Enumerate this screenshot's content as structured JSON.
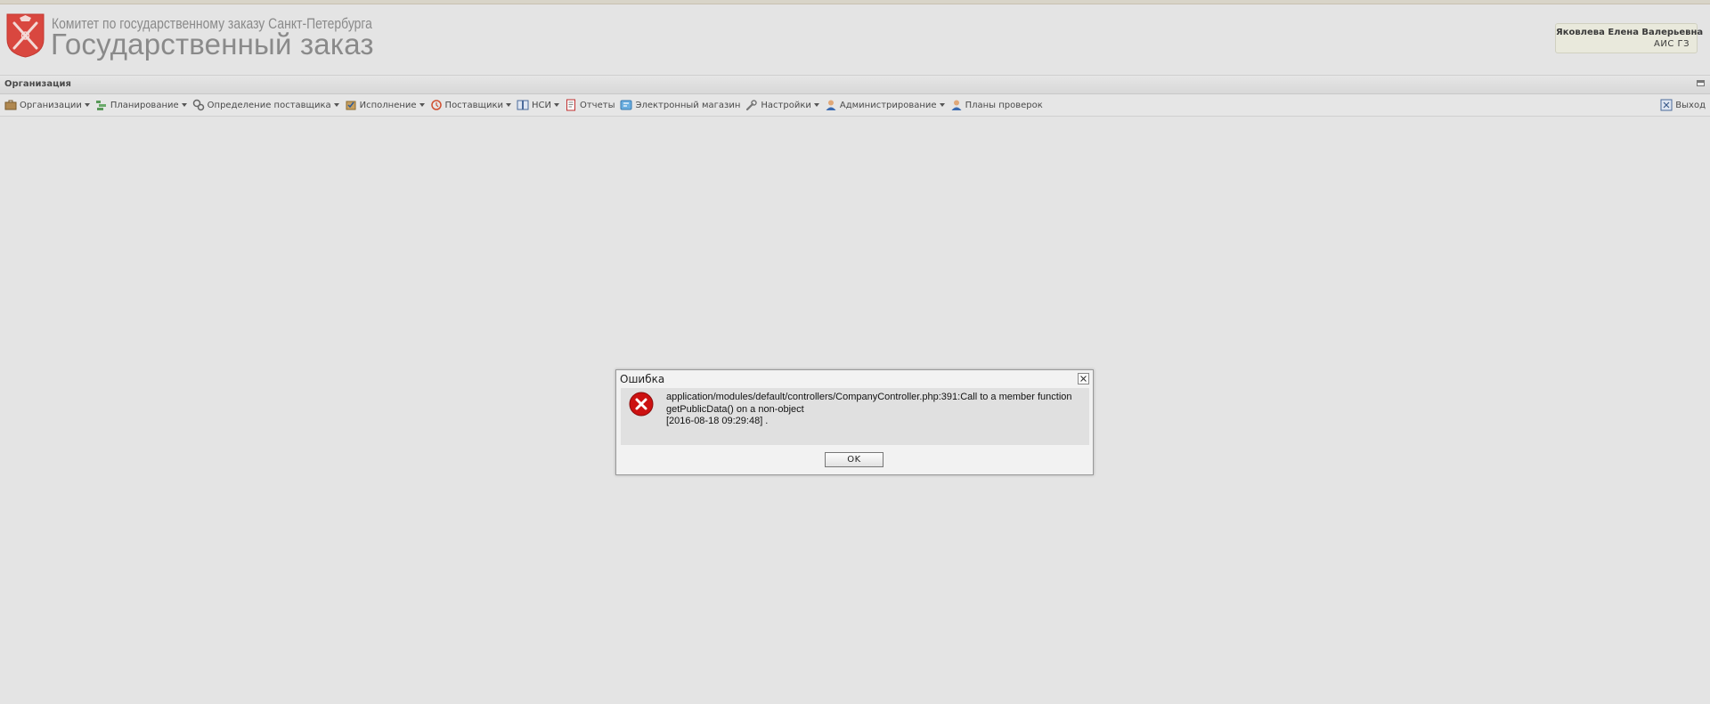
{
  "header": {
    "org_title": "Комитет по государственному заказу Санкт-Петербурга",
    "app_title": "Государственный заказ",
    "user": {
      "name": "Яковлева Елена Валерьевна",
      "system": "АИС ГЗ"
    }
  },
  "panel": {
    "title": "Организация"
  },
  "menu": {
    "items": [
      {
        "label": "Организации",
        "icon": "briefcase-icon",
        "dropdown": true
      },
      {
        "label": "Планирование",
        "icon": "plan-list-icon",
        "dropdown": true
      },
      {
        "label": "Определение поставщика",
        "icon": "gears-icon",
        "dropdown": true
      },
      {
        "label": "Исполнение",
        "icon": "execution-icon",
        "dropdown": true
      },
      {
        "label": "Поставщики",
        "icon": "suppliers-icon",
        "dropdown": true
      },
      {
        "label": "НСИ",
        "icon": "reference-book-icon",
        "dropdown": true
      },
      {
        "label": "Отчеты",
        "icon": "report-icon",
        "dropdown": false
      },
      {
        "label": "Электронный магазин",
        "icon": "shop-icon",
        "dropdown": false
      },
      {
        "label": "Настройки",
        "icon": "wrench-icon",
        "dropdown": true
      },
      {
        "label": "Администрирование",
        "icon": "admin-user-icon",
        "dropdown": true
      },
      {
        "label": "Планы проверок",
        "icon": "inspection-user-icon",
        "dropdown": false
      }
    ],
    "exit_label": "Выход"
  },
  "dialog": {
    "title": "Ошибка",
    "message_line1": "application/modules/default/controllers/CompanyController.php:391:Call to a member function",
    "message_line2": "getPublicData() on a non-object",
    "message_line3": "[2016-08-18 09:29:48] .",
    "ok_label": "OK"
  },
  "colors": {
    "background": "#e4e4e4",
    "emblem_red": "#d9473f",
    "error_red": "#cc1111",
    "title_gray": "#8a8a8a"
  }
}
